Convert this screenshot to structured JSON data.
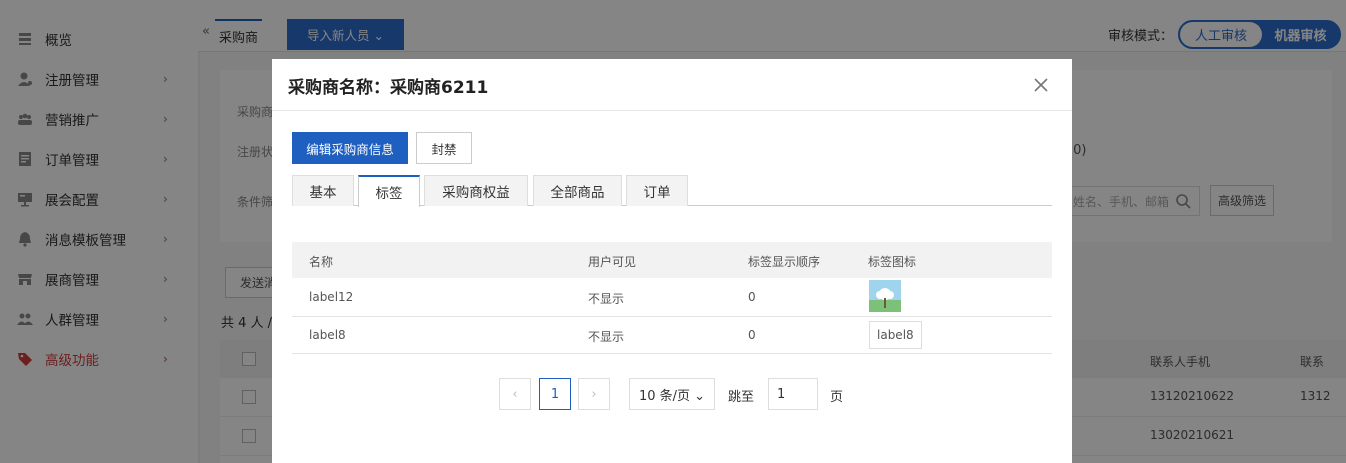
{
  "sidebar": {
    "items": [
      {
        "label": "概览",
        "icon": "overview-icon"
      },
      {
        "label": "注册管理",
        "icon": "register-icon"
      },
      {
        "label": "营销推广",
        "icon": "marketing-icon"
      },
      {
        "label": "订单管理",
        "icon": "order-icon"
      },
      {
        "label": "展会配置",
        "icon": "exhibition-icon"
      },
      {
        "label": "消息模板管理",
        "icon": "bell-icon"
      },
      {
        "label": "展商管理",
        "icon": "exhibitor-icon"
      },
      {
        "label": "人群管理",
        "icon": "people-icon"
      },
      {
        "label": "高级功能",
        "icon": "tag-icon",
        "active": true
      }
    ],
    "active_color": "#d23b3b"
  },
  "topbar": {
    "collapse_glyph": "«",
    "tab_label": "采购商",
    "import_button": "导入新人员 ⌄",
    "review_mode_label": "审核模式：",
    "review_manual": "人工审核",
    "review_machine": "机器审核"
  },
  "background": {
    "label_1": "采购商",
    "label_2": "注册状",
    "label_3": "条件筛",
    "count_suffix": "(0)",
    "search_placeholder": "姓名、手机、邮箱",
    "advanced_filter": "高级筛选",
    "send_button": "发送消",
    "total_prefix": "共 4 人 / ",
    "header_phone": "联系人手机",
    "header_contact": "联系",
    "rows": [
      {
        "phone": "13120210622",
        "extra": "1312"
      },
      {
        "phone": "13020210621",
        "extra": ""
      }
    ]
  },
  "modal": {
    "title": "采购商名称：采购商6211",
    "edit_button": "编辑采购商信息",
    "ban_button": "封禁",
    "tabs": [
      "基本",
      "标签",
      "采购商权益",
      "全部商品",
      "订单"
    ],
    "active_tab": "标签",
    "table": {
      "headers": [
        "名称",
        "用户可见",
        "标签显示顺序",
        "标签图标"
      ],
      "rows": [
        {
          "name": "label12",
          "visible": "不显示",
          "order": "0",
          "icon_type": "image"
        },
        {
          "name": "label8",
          "visible": "不显示",
          "order": "0",
          "icon_text": "label8"
        }
      ]
    },
    "pagination": {
      "prev": "‹",
      "current_page": "1",
      "next": "›",
      "page_size": "10 条/页 ⌄",
      "jump_label": "跳至",
      "jump_value": "1",
      "page_suffix": "页"
    }
  },
  "colors": {
    "primary": "#1f5fbf",
    "overlay": "rgba(0,0,0,0.48)"
  }
}
